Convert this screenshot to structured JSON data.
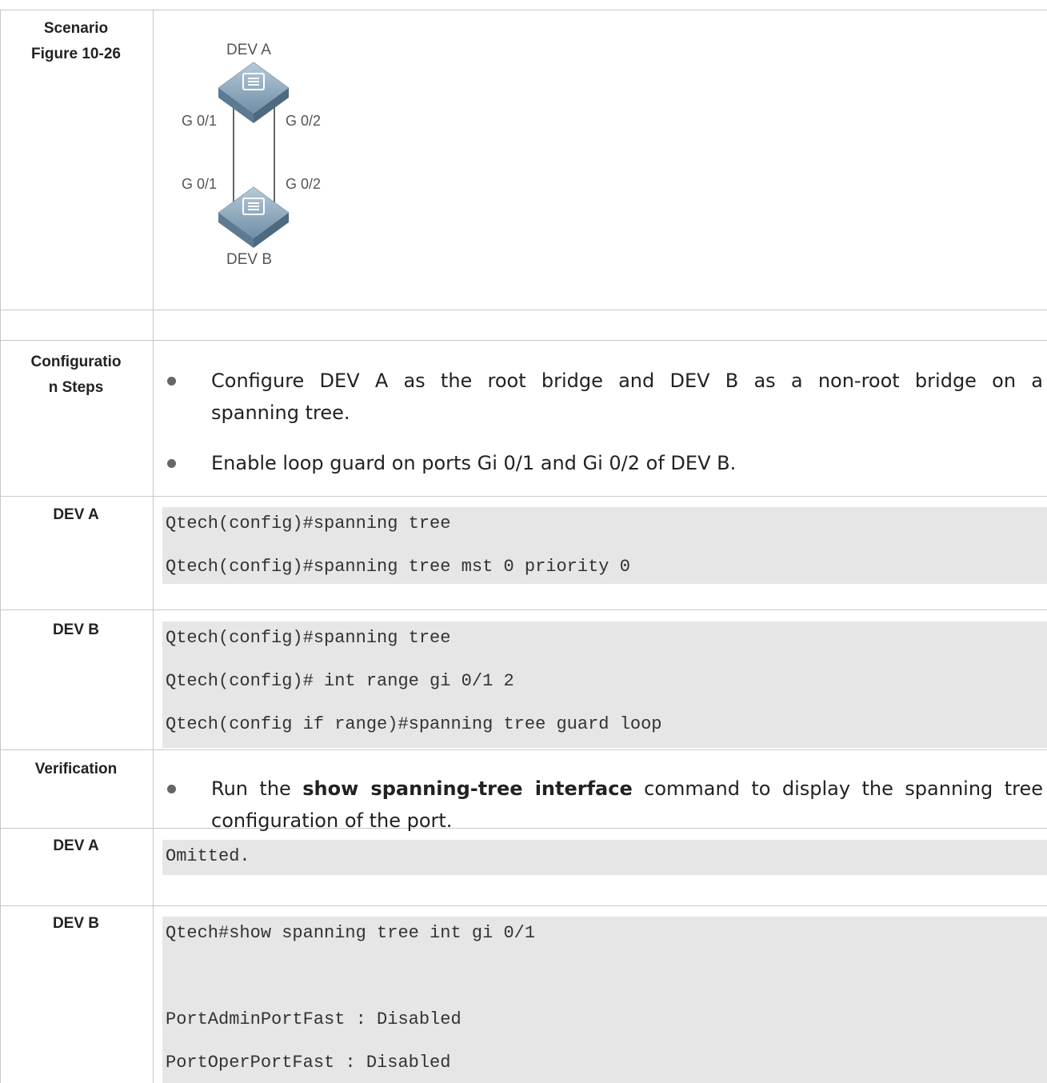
{
  "rows": {
    "scenario": {
      "label_line1": "Scenario",
      "label_line2": "Figure 10-26"
    },
    "figure": {
      "dev_a": "DEV A",
      "dev_b": "DEV B",
      "a_port_left": "G 0/1",
      "a_port_right": "G 0/2",
      "b_port_left": "G 0/1",
      "b_port_right": "G 0/2",
      "switch_icon": "switch-icon"
    },
    "config_steps": {
      "label_line1": "Configuratio",
      "label_line2": "n Steps",
      "bullet1": "Configure DEV A as the root bridge and DEV B as a non-root bridge on a spanning tree.",
      "bullet1_line1": "Configure DEV A as the root bridge and DEV B as a non-root bridge on a",
      "bullet1_line2": "spanning tree.",
      "bullet2": "Enable loop guard on ports Gi 0/1 and Gi 0/2 of DEV B."
    },
    "dev_a_config": {
      "label": "DEV A",
      "lines": [
        "Qtech(config)#spanning tree",
        "Qtech(config)#spanning tree mst 0 priority 0"
      ]
    },
    "dev_b_config": {
      "label": "DEV B",
      "lines": [
        "Qtech(config)#spanning tree",
        "Qtech(config)# int range gi 0/1 2",
        "Qtech(config if range)#spanning tree guard loop"
      ]
    },
    "verification": {
      "label": "Verification",
      "prefix": "Run the",
      "command": "show spanning-tree interface",
      "suffix_line1": "command to display the spanning tree",
      "suffix_line2": "configuration of the port."
    },
    "dev_a_verify": {
      "label": "DEV A",
      "line": "Omitted."
    },
    "dev_b_verify": {
      "label": "DEV B",
      "lines": [
        "Qtech#show spanning tree int gi 0/1",
        "",
        "PortAdminPortFast : Disabled",
        "PortOperPortFast : Disabled"
      ]
    }
  },
  "colors": {
    "border": "#c8c8c8",
    "code_bg": "#e6e6e6",
    "bullet": "#666666"
  }
}
